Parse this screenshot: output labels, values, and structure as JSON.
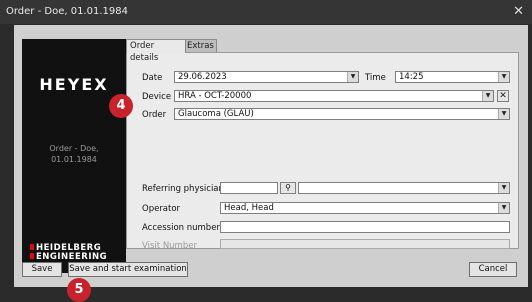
{
  "window": {
    "title": "Order - Doe, 01.01.1984",
    "close_icon": "close-icon"
  },
  "logo": {
    "brand": "HEYEX",
    "order_line1": "Order - Doe,",
    "order_line2": "01.01.1984",
    "maker_line1": "HEIDELBERG",
    "maker_line2": "ENGINEERING"
  },
  "tabs": [
    {
      "label": "Order details",
      "active": true
    },
    {
      "label": "Extras",
      "active": false
    }
  ],
  "form": {
    "date_label": "Date",
    "date_value": "29.06.2023",
    "time_label": "Time",
    "time_value": "14:25",
    "device_label": "Device",
    "device_value": "HRA - OCT-20000",
    "order_label": "Order",
    "order_value": "Glaucoma (GLAU)",
    "referring_label": "Referring physician",
    "referring_value": "",
    "operator_label": "Operator",
    "operator_value": "Head, Head",
    "accession_label": "Accession number",
    "accession_value": "",
    "visit_label": "Visit Number",
    "visit_value": ""
  },
  "buttons": {
    "save": "Save",
    "save_start": "Save and start examination",
    "cancel": "Cancel"
  },
  "badges": {
    "badge4": "4",
    "badge5": "5"
  },
  "colors": {
    "badge": "#c8232c",
    "window_bg": "#cfcfcf",
    "logo_bg": "#111111"
  }
}
